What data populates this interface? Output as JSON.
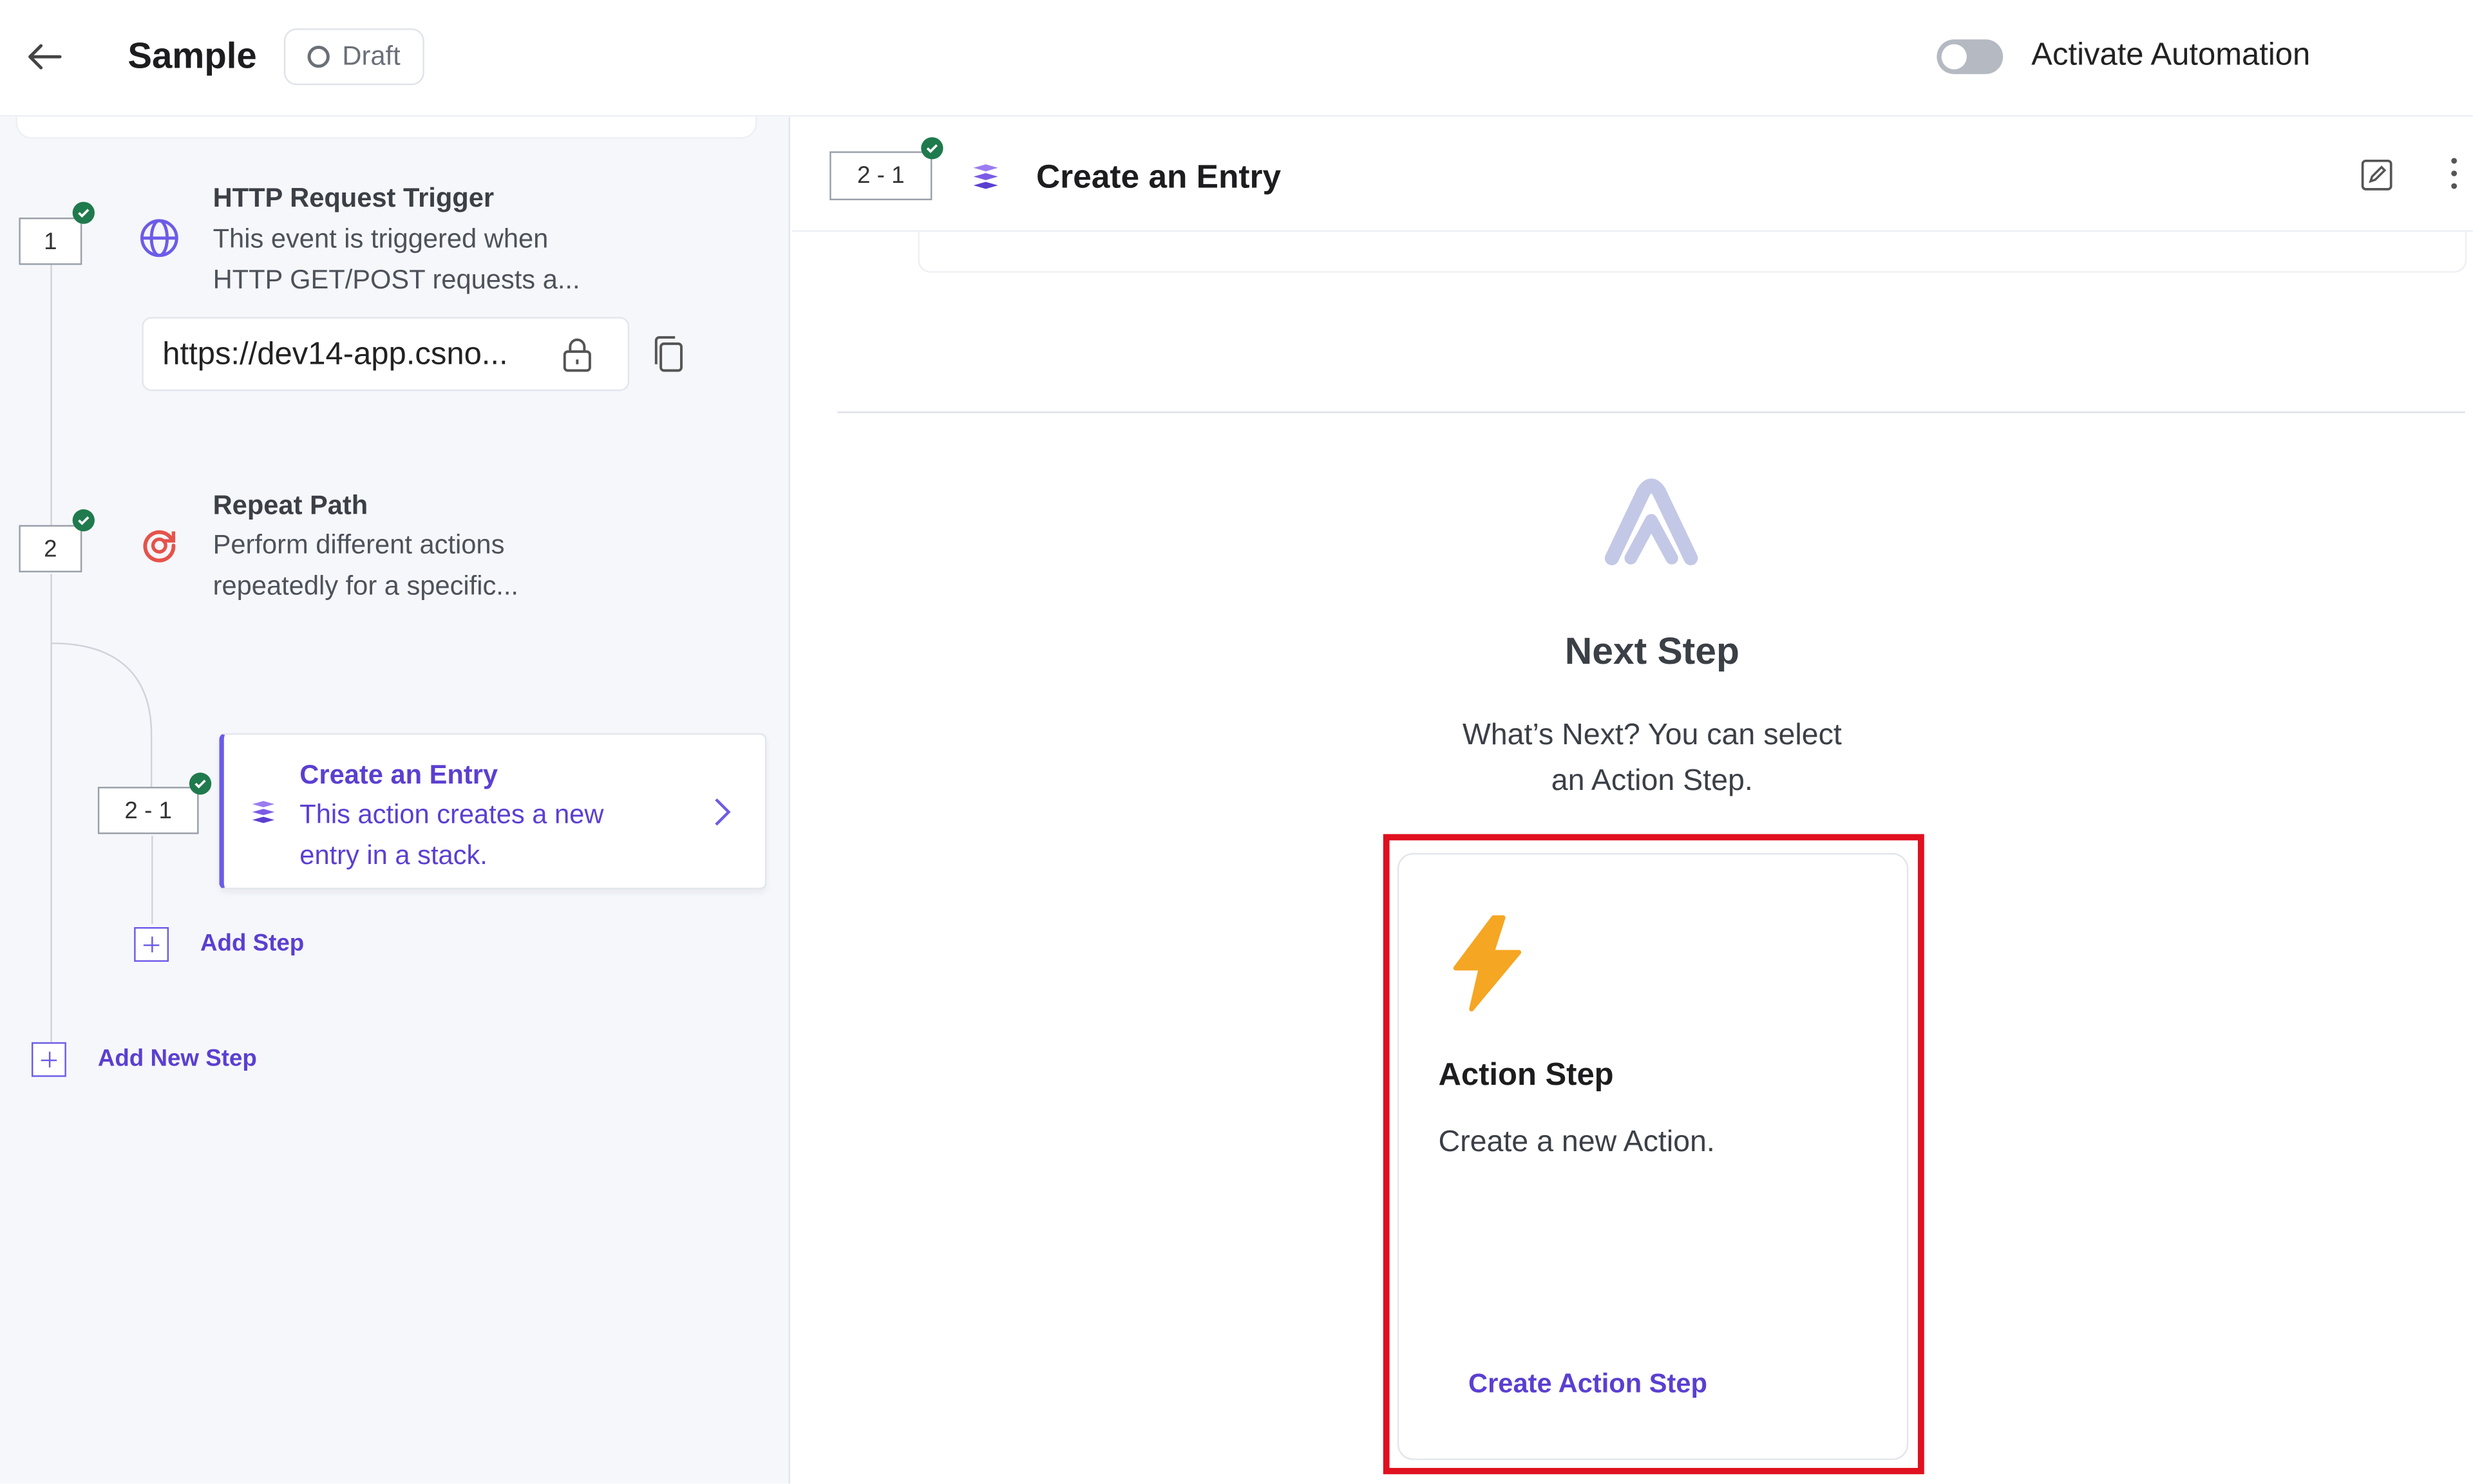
{
  "header": {
    "title": "Sample",
    "status": "Draft",
    "toggle_label": "Activate Automation",
    "toggle_on": false
  },
  "steps": [
    {
      "number": "1",
      "title": "HTTP Request Trigger",
      "desc_line1": "This event is triggered when",
      "desc_line2": "HTTP GET/POST requests a...",
      "url": "https://dev14-app.csno..."
    },
    {
      "number": "2",
      "title": "Repeat Path",
      "desc_line1": "Perform different actions",
      "desc_line2": "repeatedly for a specific..."
    }
  ],
  "substep": {
    "number": "2 - 1",
    "title": "Create an Entry",
    "desc_line1": "This action creates a new",
    "desc_line2": "entry in a stack."
  },
  "add_step_label": "Add Step",
  "add_new_step_label": "Add New Step",
  "right_panel": {
    "step_number": "2 - 1",
    "title": "Create an Entry",
    "next_title": "Next Step",
    "next_desc_line1": "What’s Next? You can select",
    "next_desc_line2": "an Action Step.",
    "action_card": {
      "title": "Action Step",
      "desc": "Create a new Action.",
      "link": "Create Action Step"
    }
  },
  "colors": {
    "accent": "#6c5ce7",
    "success": "#1f7a4d",
    "highlight": "#e0101f",
    "bolt": "#f5a623"
  }
}
